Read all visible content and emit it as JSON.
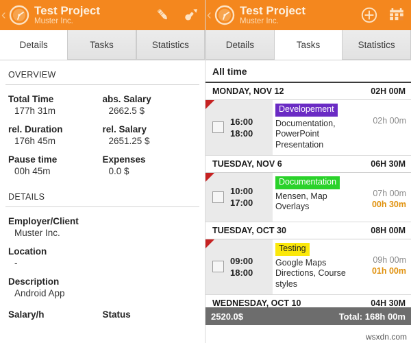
{
  "colors": {
    "accent": "#f4871e",
    "badge_development": "#6a2bc4",
    "badge_documentation": "#2ad22a",
    "badge_testing": "#fbe80b",
    "flag_red": "#c62222",
    "pause_orange": "#e0920f",
    "summary_gray": "#6d6d6d"
  },
  "left": {
    "appbar": {
      "back_icon": "back-chevron-icon",
      "logo_icon": "stopwatch-logo-icon",
      "title": "Test Project",
      "subtitle": "Muster Inc.",
      "actions": [
        {
          "name": "edit-pencil-icon",
          "label": "Edit"
        },
        {
          "name": "pin-icon",
          "label": "Pin"
        }
      ]
    },
    "tabs": [
      {
        "label": "Details",
        "active": true
      },
      {
        "label": "Tasks",
        "active": false
      },
      {
        "label": "Statistics",
        "active": false
      }
    ],
    "overview": {
      "heading": "OVERVIEW",
      "rows": [
        {
          "label": "Total Time",
          "value": "177h 31m",
          "label2": "abs. Salary",
          "value2": "2662.5 $"
        },
        {
          "label": "rel. Duration",
          "value": "176h 45m",
          "label2": "rel. Salary",
          "value2": "2651.25 $"
        },
        {
          "label": "Pause time",
          "value": "00h 45m",
          "label2": "Expenses",
          "value2": "0.0 $"
        }
      ]
    },
    "details": {
      "heading": "DETAILS",
      "fields": [
        {
          "label": "Employer/Client",
          "value": "Muster Inc."
        },
        {
          "label": "Location",
          "value": "-"
        },
        {
          "label": "Description",
          "value": "Android App"
        }
      ],
      "footer_labels": {
        "left": "Salary/h",
        "right": "Status"
      }
    }
  },
  "right": {
    "appbar": {
      "back_icon": "back-chevron-icon",
      "logo_icon": "stopwatch-logo-icon",
      "title": "Test Project",
      "subtitle": "Muster Inc.",
      "actions": [
        {
          "name": "add-circle-icon",
          "label": "Add"
        },
        {
          "name": "calendar-icon",
          "label": "Calendar"
        }
      ]
    },
    "tabs": [
      {
        "label": "Details",
        "active": false
      },
      {
        "label": "Tasks",
        "active": true
      },
      {
        "label": "Statistics",
        "active": false
      }
    ],
    "filter_label": "All time",
    "days": [
      {
        "date": "MONDAY, NOV 12",
        "day_total": "02H 00M",
        "task": {
          "start": "16:00",
          "end": "18:00",
          "badge": "Developement",
          "badge_color": "#6a2bc4",
          "badge_text_color": "#ffffff",
          "description": "Documentation, PowerPoint Presentation",
          "duration": "02h 00m",
          "pause": ""
        }
      },
      {
        "date": "TUESDAY, NOV 6",
        "day_total": "06H 30M",
        "task": {
          "start": "10:00",
          "end": "17:00",
          "badge": "Documentation",
          "badge_color": "#2ad22a",
          "badge_text_color": "#ffffff",
          "description": "Mensen, Map Overlays",
          "duration": "07h 00m",
          "pause": "00h 30m"
        }
      },
      {
        "date": "TUESDAY, OCT 30",
        "day_total": "08H 00M",
        "task": {
          "start": "09:00",
          "end": "18:00",
          "badge": "Testing",
          "badge_color": "#fbe80b",
          "badge_text_color": "#1d1d1d",
          "description": "Google Maps Directions, Course styles",
          "duration": "09h 00m",
          "pause": "01h 00m"
        }
      },
      {
        "date": "WEDNESDAY, OCT 10",
        "day_total": "04H 30M",
        "task": null
      }
    ],
    "summary": {
      "amount": "2520.0$",
      "total": "Total: 168h 00m"
    }
  },
  "watermark": "wsxdn.com"
}
